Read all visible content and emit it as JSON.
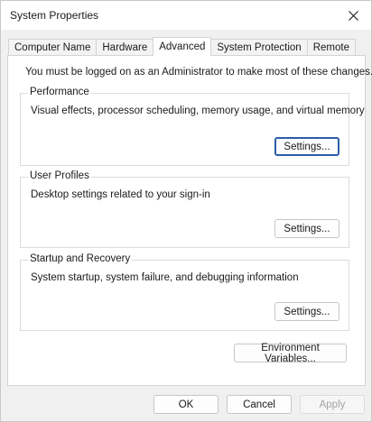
{
  "window": {
    "title": "System Properties"
  },
  "tabs": [
    {
      "label": "Computer Name"
    },
    {
      "label": "Hardware"
    },
    {
      "label": "Advanced"
    },
    {
      "label": "System Protection"
    },
    {
      "label": "Remote"
    }
  ],
  "advanced": {
    "notice": "You must be logged on as an Administrator to make most of these changes.",
    "performance": {
      "label": "Performance",
      "description": "Visual effects, processor scheduling, memory usage, and virtual memory",
      "button": "Settings..."
    },
    "user_profiles": {
      "label": "User Profiles",
      "description": "Desktop settings related to your sign-in",
      "button": "Settings..."
    },
    "startup_recovery": {
      "label": "Startup and Recovery",
      "description": "System startup, system failure, and debugging information",
      "button": "Settings..."
    },
    "env_button": "Environment Variables..."
  },
  "footer": {
    "ok": "OK",
    "cancel": "Cancel",
    "apply": "Apply"
  }
}
